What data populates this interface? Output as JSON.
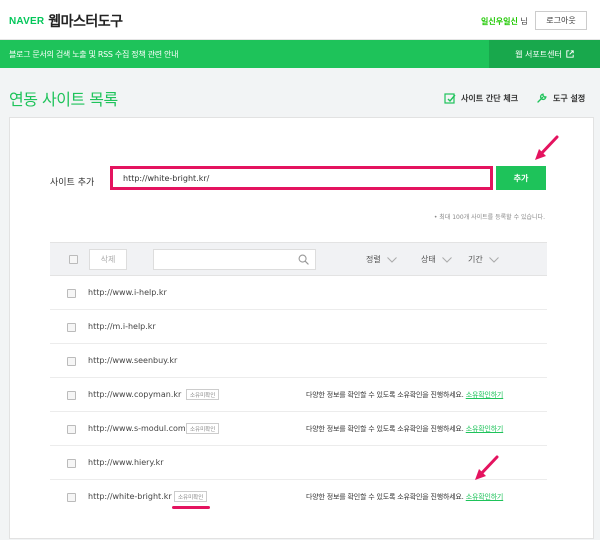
{
  "header": {
    "logo_naver": "NAVER",
    "logo_product": "웹마스터도구",
    "user_name": "일신우일신",
    "user_suffix": " 님",
    "logout_label": "로그아웃"
  },
  "banner": {
    "notice": "블로그 문서의 검색 노출 및 RSS 수집 정책 관련 안내",
    "support_label": "웹 서포트센터"
  },
  "page": {
    "title": "연동 사이트 목록",
    "site_check_label": "사이트 간단 체크",
    "tool_settings_label": "도구 설정"
  },
  "add_site": {
    "label": "사이트 추가",
    "value": "http://white-bright.kr/",
    "button": "추가",
    "limit_note": "• 최대 100개 사이트를 등록할 수 있습니다."
  },
  "toolbar": {
    "delete_label": "삭제",
    "search_placeholder": "",
    "sort_label": "정렬",
    "status_label": "상태",
    "period_label": "기간"
  },
  "sites": [
    {
      "url": "http://www.i-help.kr",
      "badge": "",
      "message": "",
      "link": ""
    },
    {
      "url": "http://m.i-help.kr",
      "badge": "",
      "message": "",
      "link": ""
    },
    {
      "url": "http://www.seenbuy.kr",
      "badge": "",
      "message": "",
      "link": ""
    },
    {
      "url": "http://www.copyman.kr",
      "badge": "소유미확인",
      "message": "다양한 정보를 확인할 수 있도록 소유확인을 진행하세요.",
      "link": "소유확인하기"
    },
    {
      "url": "http://www.s-modul.com",
      "badge": "소유미확인",
      "message": "다양한 정보를 확인할 수 있도록 소유확인을 진행하세요.",
      "link": "소유확인하기"
    },
    {
      "url": "http://www.hiery.kr",
      "badge": "",
      "message": "",
      "link": ""
    },
    {
      "url": "http://white-bright.kr",
      "badge": "소유미확인",
      "message": "다양한 정보를 확인할 수 있도록 소유확인을 진행하세요.",
      "link": "소유확인하기"
    }
  ],
  "colors": {
    "brand_green": "#1ec35a",
    "highlight_pink": "#e4135f"
  }
}
